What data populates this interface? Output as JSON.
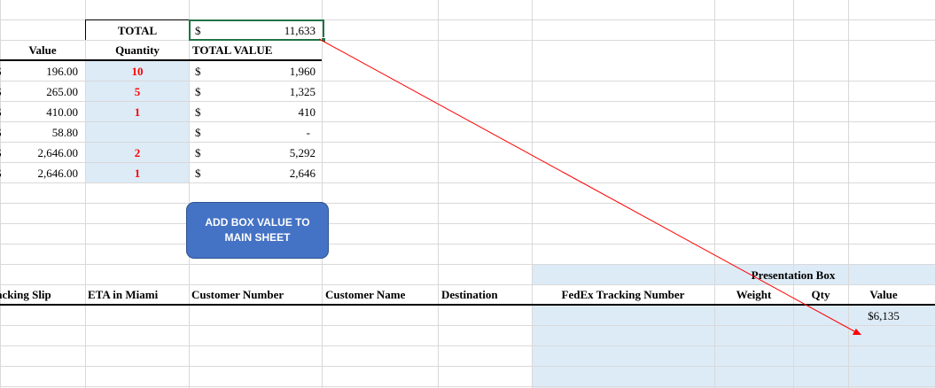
{
  "summary": {
    "total_label": "TOTAL",
    "total_currency": "$",
    "total_value": "11,633"
  },
  "items_table": {
    "headers": {
      "value": "Value",
      "quantity": "Quantity",
      "total_value": "TOTAL VALUE"
    },
    "rows": [
      {
        "cur": "$",
        "value": "196.00",
        "quantity": "10",
        "total_cur": "$",
        "total": "1,960"
      },
      {
        "cur": "$",
        "value": "265.00",
        "quantity": "5",
        "total_cur": "$",
        "total": "1,325"
      },
      {
        "cur": "$",
        "value": "410.00",
        "quantity": "1",
        "total_cur": "$",
        "total": "410"
      },
      {
        "cur": "$",
        "value": "58.80",
        "quantity": "",
        "total_cur": "$",
        "total": "-"
      },
      {
        "cur": "$",
        "value": "2,646.00",
        "quantity": "2",
        "total_cur": "$",
        "total": "5,292"
      },
      {
        "cur": "$",
        "value": "2,646.00",
        "quantity": "1",
        "total_cur": "$",
        "total": "2,646"
      }
    ]
  },
  "macro_button": {
    "label": "ADD BOX VALUE TO MAIN SHEET"
  },
  "shipping_table": {
    "headers": {
      "tracking_slip": "acking Slip",
      "eta": "ETA in Miami",
      "customer_number": "Customer Number",
      "customer_name": "Customer Name",
      "destination": "Destination",
      "fedex": "FedEx Tracking Number",
      "weight": "Weight",
      "qty": "Qty",
      "value": "Value"
    },
    "group_header": "Presentation Box",
    "value_cell": "$6,135"
  },
  "colors": {
    "selection": "#217346",
    "input_fill": "#ddebf7",
    "quantity_text": "#ff0000",
    "button_fill": "#4472c4",
    "arrow": "#ff0000"
  }
}
